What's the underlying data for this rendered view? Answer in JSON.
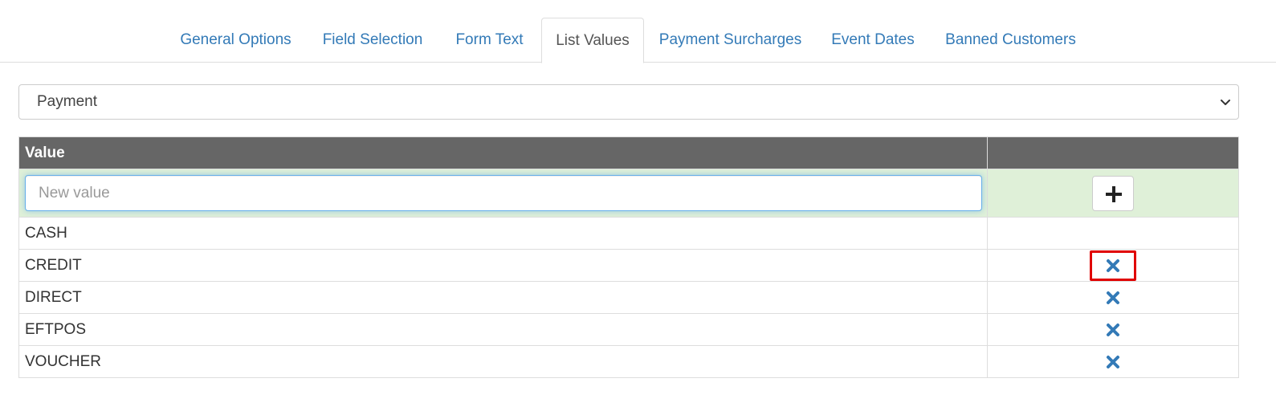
{
  "tabs": [
    {
      "label": "General Options"
    },
    {
      "label": "Field Selection"
    },
    {
      "label": "Form Text"
    },
    {
      "label": "List Values",
      "active": true
    },
    {
      "label": "Payment Surcharges"
    },
    {
      "label": "Event Dates"
    },
    {
      "label": "Banned Customers"
    }
  ],
  "list_select": {
    "selected": "Payment",
    "icon": "chevron-down-icon"
  },
  "table": {
    "header_value": "Value",
    "header_actions": "",
    "new_value_placeholder": "New value",
    "new_value_text": "",
    "add_icon": "plus-icon",
    "delete_icon": "close-icon",
    "rows": [
      {
        "value": "CASH",
        "deletable": false
      },
      {
        "value": "CREDIT",
        "deletable": true,
        "highlighted": true
      },
      {
        "value": "DIRECT",
        "deletable": true
      },
      {
        "value": "EFTPOS",
        "deletable": true
      },
      {
        "value": "VOUCHER",
        "deletable": true
      }
    ]
  },
  "colors": {
    "link": "#337ab7",
    "header_bg": "#666666",
    "new_row_bg": "#dff0d8",
    "delete_icon": "#337ab7",
    "highlight_border": "#e00000"
  }
}
